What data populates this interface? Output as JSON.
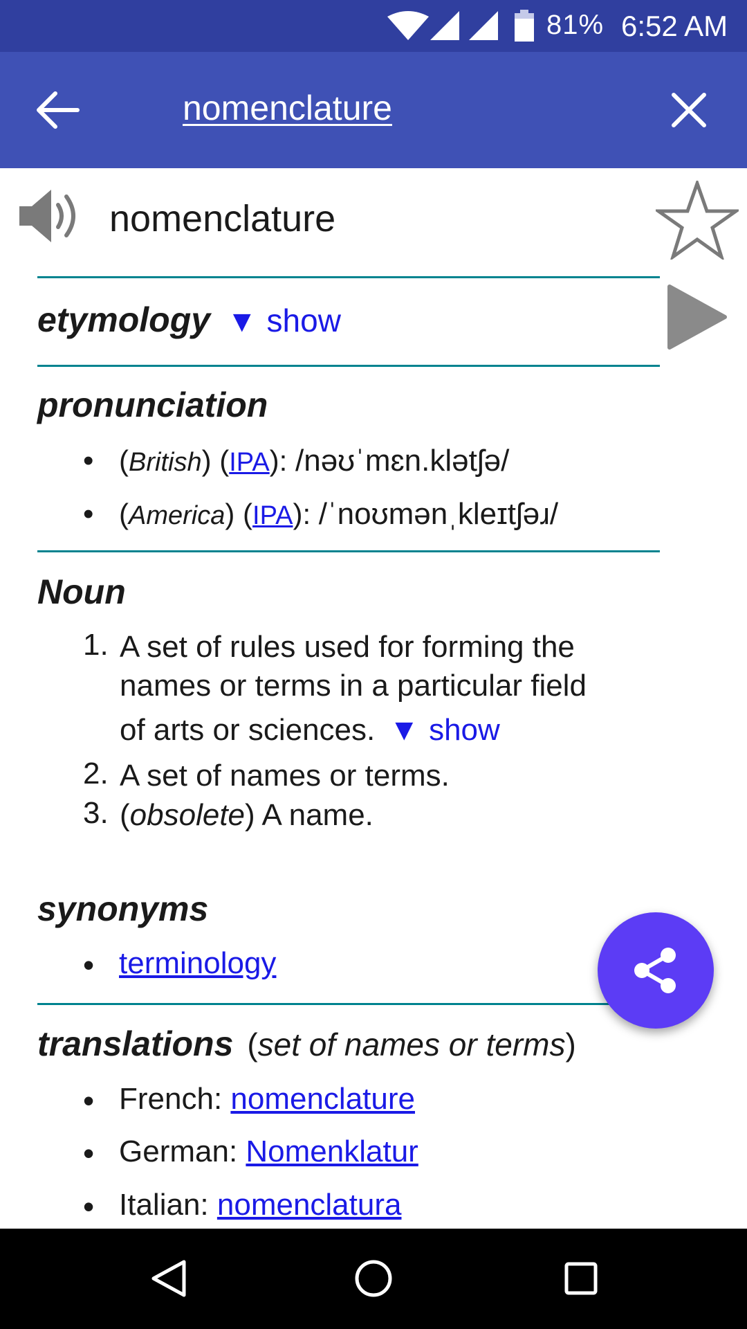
{
  "status_bar": {
    "battery_percent": "81%",
    "time": "6:52 AM",
    "icons": [
      "wifi-icon",
      "cell-signal-icon",
      "cell-signal-icon",
      "battery-icon"
    ]
  },
  "app_bar": {
    "query": "nomenclature",
    "icons": [
      "back-arrow-icon",
      "close-icon"
    ]
  },
  "entry": {
    "headword": "nomenclature",
    "icons": [
      "speaker-icon",
      "star-icon",
      "play-icon"
    ]
  },
  "etymology": {
    "title": "etymology",
    "toggle_label": "show",
    "toggle_icon": "▼"
  },
  "pronunciation": {
    "title": "pronunciation",
    "items": [
      {
        "open": "(",
        "region": "British",
        "close": ") (",
        "ipa_link": "IPA",
        "after": "): ",
        "ipa": "/nəʊˈmɛn.klətʃə/"
      },
      {
        "open": "(",
        "region": "America",
        "close": ") (",
        "ipa_link": "IPA",
        "after": "): ",
        "ipa": "/ˈnoʊmənˌkleɪtʃəɹ/"
      }
    ]
  },
  "noun": {
    "title": "Noun",
    "definitions": [
      {
        "num": "1.",
        "lines": [
          "A set of rules used for forming the",
          "names or terms in a particular field",
          "of arts or sciences."
        ],
        "toggle_label": "show"
      },
      {
        "num": "2.",
        "text": "A set of names or terms."
      },
      {
        "num": "3.",
        "open": "(",
        "qualifier": "obsolete",
        "text": ") A name."
      }
    ]
  },
  "synonyms": {
    "title": "synonyms",
    "items": [
      "terminology"
    ]
  },
  "translations": {
    "title": "translations",
    "gloss_open": "(",
    "gloss": "set of names or terms",
    "gloss_close": ")",
    "items": [
      {
        "language": "French: ",
        "word": "nomenclature"
      },
      {
        "language": "German: ",
        "word": "Nomenklatur"
      },
      {
        "language": "Italian: ",
        "word": "nomenclatura"
      }
    ]
  },
  "fab": {
    "icon": "share-icon"
  },
  "nav_bar": {
    "icons": [
      "back-triangle-icon",
      "home-circle-icon",
      "recents-square-icon"
    ]
  },
  "colors": {
    "status_bar": "#303f9f",
    "app_bar": "#3f51b5",
    "divider": "#00838f",
    "link": "#1a1ae6",
    "fab": "#5c3cf5"
  }
}
